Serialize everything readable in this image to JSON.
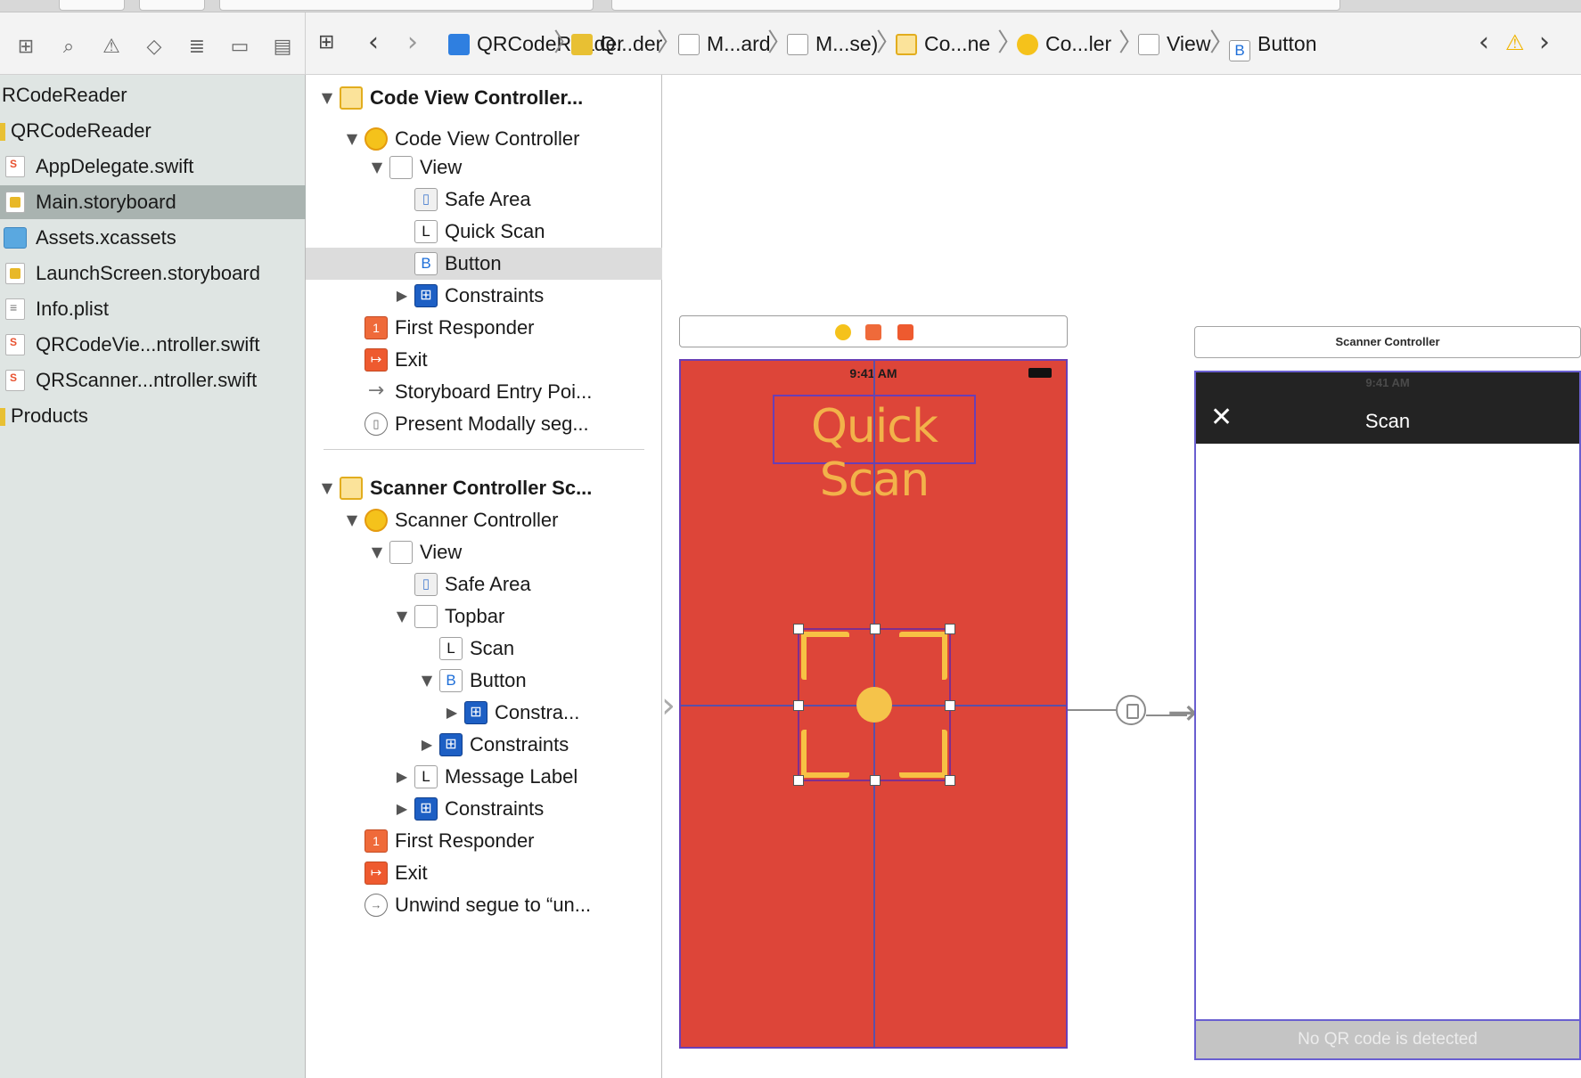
{
  "navigator": {
    "items": [
      {
        "label": "RCodeReader",
        "icon": "none"
      },
      {
        "label": "QRCodeReader",
        "icon": "folder-icon"
      },
      {
        "label": "AppDelegate.swift",
        "icon": "swift-file-icon"
      },
      {
        "label": "Main.storyboard",
        "icon": "storyboard-file-icon"
      },
      {
        "label": "Assets.xcassets",
        "icon": "assets-folder-icon"
      },
      {
        "label": "LaunchScreen.storyboard",
        "icon": "storyboard-file-icon"
      },
      {
        "label": "Info.plist",
        "icon": "plist-file-icon"
      },
      {
        "label": "QRCodeVie...ntroller.swift",
        "icon": "swift-file-icon"
      },
      {
        "label": "QRScanner...ntroller.swift",
        "icon": "swift-file-icon"
      },
      {
        "label": "Products",
        "icon": "folder-icon"
      }
    ]
  },
  "jumpbar": {
    "crumbs": [
      "QRCodeReader",
      "Q...der",
      "M...ard",
      "M...se)",
      "Co...ne",
      "Co...ler",
      "View",
      "Button"
    ],
    "button_icon_letter": "B"
  },
  "outline": {
    "rows": [
      {
        "label": "Code View Controller...",
        "icon": "scene",
        "disc": "▼",
        "bold": true
      },
      {
        "label": "Code View Controller",
        "icon": "vc",
        "disc": "▼"
      },
      {
        "label": "View",
        "icon": "view",
        "disc": "▼"
      },
      {
        "label": "Safe Area",
        "icon": "safe",
        "disc": ""
      },
      {
        "label": "Quick Scan",
        "icon": "label",
        "disc": ""
      },
      {
        "label": "Button",
        "icon": "button",
        "disc": "",
        "selected": true
      },
      {
        "label": "Constraints",
        "icon": "cons",
        "disc": "▶"
      },
      {
        "label": "First Responder",
        "icon": "fr",
        "disc": ""
      },
      {
        "label": "Exit",
        "icon": "exit",
        "disc": ""
      },
      {
        "label": "Storyboard Entry Poi...",
        "icon": "arrow",
        "disc": ""
      },
      {
        "label": "Present Modally seg...",
        "icon": "seg",
        "disc": ""
      },
      {
        "label": "Scanner Controller Sc...",
        "icon": "scene",
        "disc": "▼",
        "bold": true
      },
      {
        "label": "Scanner Controller",
        "icon": "vc",
        "disc": "▼"
      },
      {
        "label": "View",
        "icon": "view",
        "disc": "▼"
      },
      {
        "label": "Safe Area",
        "icon": "safe",
        "disc": ""
      },
      {
        "label": "Topbar",
        "icon": "view",
        "disc": "▼"
      },
      {
        "label": "Scan",
        "icon": "label",
        "disc": ""
      },
      {
        "label": "Button",
        "icon": "button",
        "disc": "▼"
      },
      {
        "label": "Constra...",
        "icon": "cons",
        "disc": "▶"
      },
      {
        "label": "Constraints",
        "icon": "cons",
        "disc": "▶"
      },
      {
        "label": "Message Label",
        "icon": "label",
        "disc": "▶"
      },
      {
        "label": "Constraints",
        "icon": "cons",
        "disc": "▶"
      },
      {
        "label": "First Responder",
        "icon": "fr",
        "disc": ""
      },
      {
        "label": "Exit",
        "icon": "exit",
        "disc": ""
      },
      {
        "label": "Unwind segue to “un...",
        "icon": "unwind",
        "disc": ""
      }
    ],
    "icon_letters": {
      "label": "L",
      "button": "B"
    }
  },
  "canvas": {
    "scene1": {
      "status_time": "9:41 AM",
      "title_label": "Quick Scan",
      "background_color": "#dd4539",
      "accent_color": "#f7c144"
    },
    "scene2": {
      "scene_title": "Scanner Controller",
      "status_time": "9:41 AM",
      "close_glyph": "✕",
      "topbar_title": "Scan",
      "message": "No QR code is detected"
    }
  }
}
